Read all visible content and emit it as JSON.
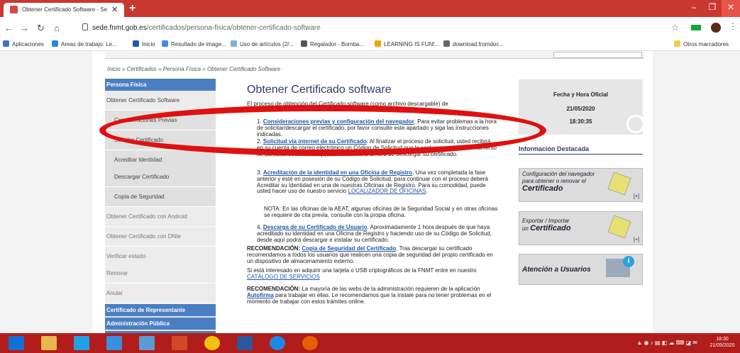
{
  "browser": {
    "tab_title": "Obtener Certificado Software - Se",
    "new_tab": "+",
    "url_host": "sede.fnmt.gob.es",
    "url_path": "/certificados/persona-fisica/obtener-certificado-software",
    "window_controls": [
      "–",
      "❐",
      "✕"
    ]
  },
  "bookmarks": {
    "apps": "Aplicaciones",
    "items": [
      {
        "label": "Areas de trabajo: Le...",
        "color": "#1e88e5"
      },
      {
        "label": "Inicio",
        "color": "#1e5aa6"
      },
      {
        "label": "Resultado de image...",
        "color": "#4285f4"
      },
      {
        "label": "Uso de artículos (2/...",
        "color": "#7ab0d8"
      },
      {
        "label": "Regalador - Bomba...",
        "color": "#555555"
      },
      {
        "label": "LEARNING IS FUN!...",
        "color": "#f4a300"
      },
      {
        "label": "download.fromdoc...",
        "color": "#666666"
      }
    ],
    "other": "Otros marcadores"
  },
  "breadcrumb": "Inicio  »  Certificados  »  Persona Física  »   Obtener Certificado Software",
  "sidebar": {
    "header1": "Persona Física",
    "items": [
      "Obtener Certificado Software",
      "Consideraciones Previas",
      "Solicitar Certificado",
      "Acreditar Identidad",
      "Descargar Certificado",
      "Copia de Seguridad",
      "Obtener Certificado con Android",
      "Obtener Certificado con DNIe",
      "Verificar estado",
      "Renovar",
      "Anular"
    ],
    "header2": "Certificado de Representante",
    "header3": "Administración Pública",
    "header4": "Certificado de componente"
  },
  "main": {
    "title": "Obtener Certificado software",
    "intro": "El proceso de obtención del Certificado software (como archivo descargable) de",
    "step1_link": "Consideraciones previas y configuración del navegador",
    "step1_text": ". Para evitar problemas a la hora de solicitar/descargar el certificado, por favor consulte este apartado y siga las instrucciones indicadas.",
    "step2_link": "Solicitud vía internet de su Certificado",
    "step2_text": ". Al finalizar el proceso de solicitud, usted recibirá en su cuenta de correo electrónico un Código de Solicitud que le será requerido en el momento de acreditar su identidad y posteriormente a la hora de descargar su certificado.",
    "step3_link": "Acreditación de la identidad en una Oficina de Registro",
    "step3_text": ". Una vez completada la fase anterior y esté en posesión de su Código de Solicitud, para continuar con el proceso deberá Acreditar su Identidad en una de nuestras Oficinas de Registro. Para su comodidad, puede usted hacer uso de nuestro servicio ",
    "step3_link2": "LOCALIZADOR DE OFICINAS",
    "note": "NOTA: En las oficinas de la AEAT, algunas oficinas de la Seguridad Social y en otras oficinas se requiere de cita previa, consulte con la propia oficina.",
    "step4_link": "Descarga de su Certificado de Usuario",
    "step4_text": ". Aproximadamente 1 hora después de que haya acreditado su identidad en una Oficina de Registro y haciendo uso de su Código de Solicitud, desde aquí podrá descargar e instalar su certificado.",
    "rec1_label": "RECOMENDACIÓN:",
    "rec1_link": "Copia de Seguridad del Certificado",
    "rec1_text": ". Tras descargar su certificado recomendamos a todos los usuarios que realicen una copia de seguridad del propio certificado en un dispositivo de almacenamiento externo.",
    "tarjeta_text": "Si está interesado en adquirir una tarjeta o USB criptográficos de la FNMT entre en nuestro ",
    "tarjeta_link": "CATÁLOGO DE SERVICIOS",
    "rec2_label": "RECOMENDACIÓN:",
    "rec2_text1": " La mayoría de las webs de la administración requieren de la aplicación ",
    "rec2_link": "Autofirma",
    "rec2_text2": " para trabajar en ellas. Le recomendamos que la instale para no tener problemas en el momento de trabajar con estos trámites online."
  },
  "right": {
    "date_label": "Fecha y Hora Oficial",
    "date": "21/05/2020",
    "time": "18:30:35",
    "info_header": "Información Destacada",
    "promo1_line1": "Configuración del navegador",
    "promo1_line2": "para obtener o renovar el",
    "promo1_line3": "Certificado",
    "promo2_line1": "Exportar / Importar",
    "promo2_line2a": "un ",
    "promo2_line2b": "Certificado",
    "promo3": "Atención a Usuarios",
    "plus": "[+]"
  },
  "taskbar": {
    "time": "18:30",
    "date": "21/05/2020"
  }
}
